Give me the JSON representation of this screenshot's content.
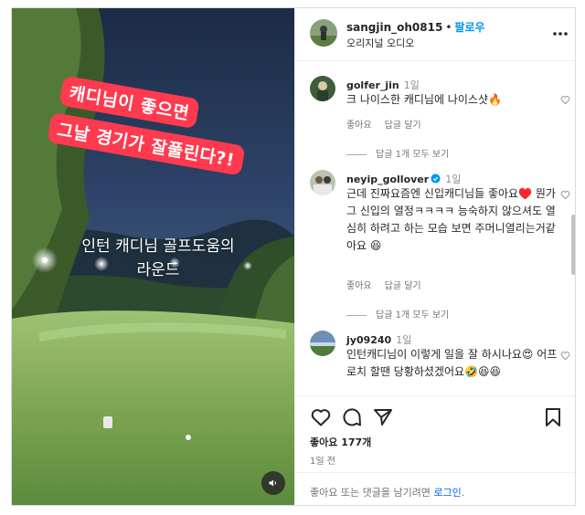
{
  "media": {
    "sticker_line1": "캐디님이 좋으면",
    "sticker_line2": "그날 경기가 잘풀린다?!",
    "caption_line1": "인턴 캐디님 골프도움의",
    "caption_line2": "라운드",
    "sound_icon": "speaker-icon"
  },
  "header": {
    "username": "sangjin_oh0815",
    "separator": "•",
    "follow_label": "팔로우",
    "audio_label": "오리지널 오디오"
  },
  "comments": [
    {
      "username": "golfer_jin",
      "time": "1일",
      "text": "크 나이스한 캐디님에 나이스샷🔥",
      "like_label": "좋아요",
      "reply_label": "답글 달기",
      "replies_label": "답글 1개 모두 보기"
    },
    {
      "username": "neyip_gollover",
      "time": "1일",
      "text": "근데 진짜요즘엔 신입캐디님들 좋아요♥️ 뭔가 그 신입의 열정ㅋㅋㅋㅋ 능숙하지 않으셔도 열심히 하려고 하는 모습 보면 주머니열리는거같아요 😆",
      "like_label": "좋아요",
      "reply_label": "답글 달기",
      "replies_label": "답글 1개 모두 보기"
    },
    {
      "username": "jy09240",
      "time": "1일",
      "text": "인턴캐디님이 이렇게 일을 잘 하시나요😍 어프로치 할땐 당황하셨겠어요🤣😆😆"
    }
  ],
  "actions": {
    "likes": "좋아요 177개",
    "post_time": "1일 전"
  },
  "login": {
    "prompt": "좋아요 또는 댓글을 남기려면",
    "link": "로그인",
    "suffix": "."
  },
  "colors": {
    "accent_blue": "#0095f6",
    "sticker_red": "#ff3a4e",
    "verified_blue": "#0095f6"
  }
}
